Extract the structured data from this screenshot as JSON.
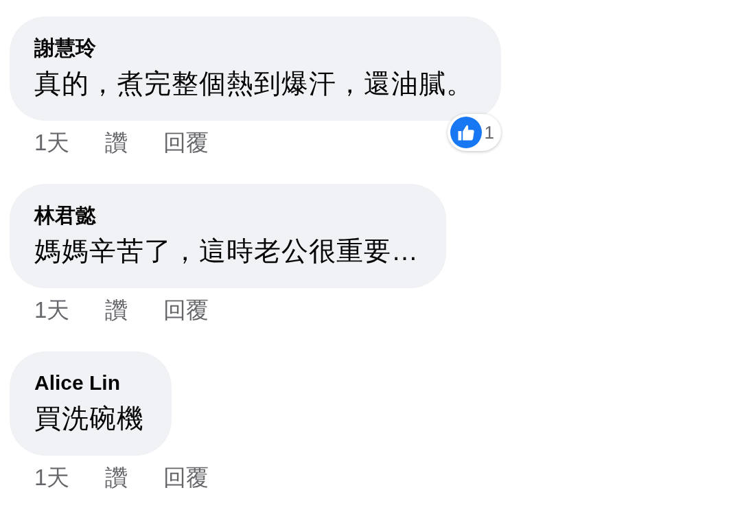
{
  "comments": [
    {
      "author": "謝慧玲",
      "text": "真的，煮完整個熱到爆汗，還油膩。",
      "time": "1天",
      "like_label": "讚",
      "reply_label": "回覆",
      "reactions": {
        "count": "1"
      }
    },
    {
      "author": "林君懿",
      "text": "媽媽辛苦了，這時老公很重要…",
      "time": "1天",
      "like_label": "讚",
      "reply_label": "回覆"
    },
    {
      "author": "Alice Lin",
      "text": "買洗碗機",
      "time": "1天",
      "like_label": "讚",
      "reply_label": "回覆"
    }
  ]
}
